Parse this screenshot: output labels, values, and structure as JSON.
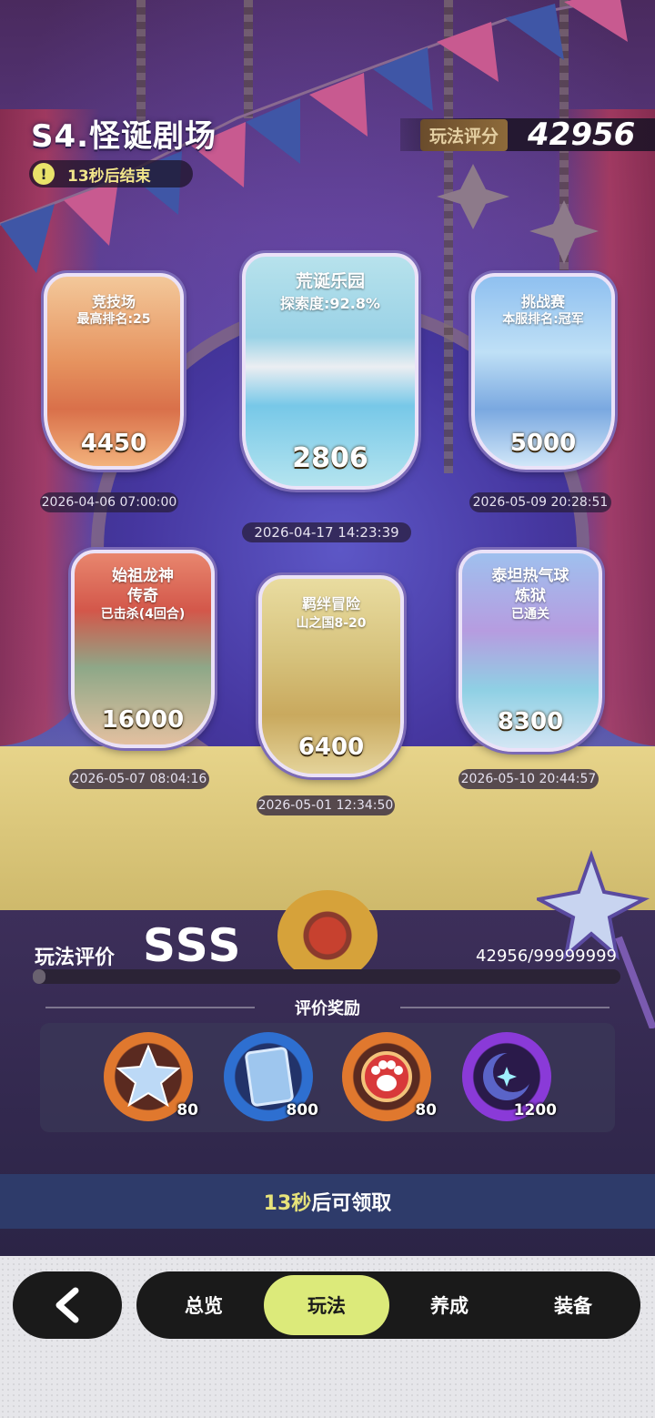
{
  "header": {
    "title": "S4.怪诞剧场",
    "countdown": "13秒后结束",
    "score_label": "玩法评分",
    "score_value": "42956"
  },
  "cards": [
    {
      "name": "竞技场",
      "sub": "最高排名:25",
      "value": "4450",
      "time": "2026-04-06 07:00:00"
    },
    {
      "name": "荒诞乐园",
      "sub": "探索度:92.8%",
      "value": "2806",
      "time": "2026-04-17 14:23:39"
    },
    {
      "name": "挑战赛",
      "sub": "本服排名:冠军",
      "value": "5000",
      "time": "2026-05-09 20:28:51"
    },
    {
      "name": "始祖龙神",
      "name2": "传奇",
      "sub": "已击杀(4回合)",
      "value": "16000",
      "time": "2026-05-07 08:04:16"
    },
    {
      "name": "羁绊冒险",
      "sub": "山之国8-20",
      "value": "6400",
      "time": "2026-05-01 12:34:50"
    },
    {
      "name": "泰坦热气球",
      "name2": "炼狱",
      "sub": "已通关",
      "value": "8300",
      "time": "2026-05-10 20:44:57"
    }
  ],
  "rating": {
    "label": "玩法评价",
    "grade": "SSS",
    "progress_text": "42956/99999999",
    "progress_fraction": 0.0004
  },
  "rewards": {
    "title": "评价奖励",
    "items": [
      {
        "icon": "crystal-star-icon",
        "count": "80",
        "ring": "#e0782e"
      },
      {
        "icon": "card-pack-icon",
        "count": "800",
        "ring": "#2e6fd0"
      },
      {
        "icon": "paw-charm-icon",
        "count": "80",
        "ring": "#e0782e"
      },
      {
        "icon": "moon-orb-icon",
        "count": "1200",
        "ring": "#8a3ad8"
      }
    ]
  },
  "claim": {
    "highlight": "13秒",
    "rest": "后可领取"
  },
  "nav": {
    "back_icon": "chevron-left-icon",
    "tabs": [
      "总览",
      "玩法",
      "养成",
      "装备"
    ],
    "active_tab": "玩法"
  }
}
